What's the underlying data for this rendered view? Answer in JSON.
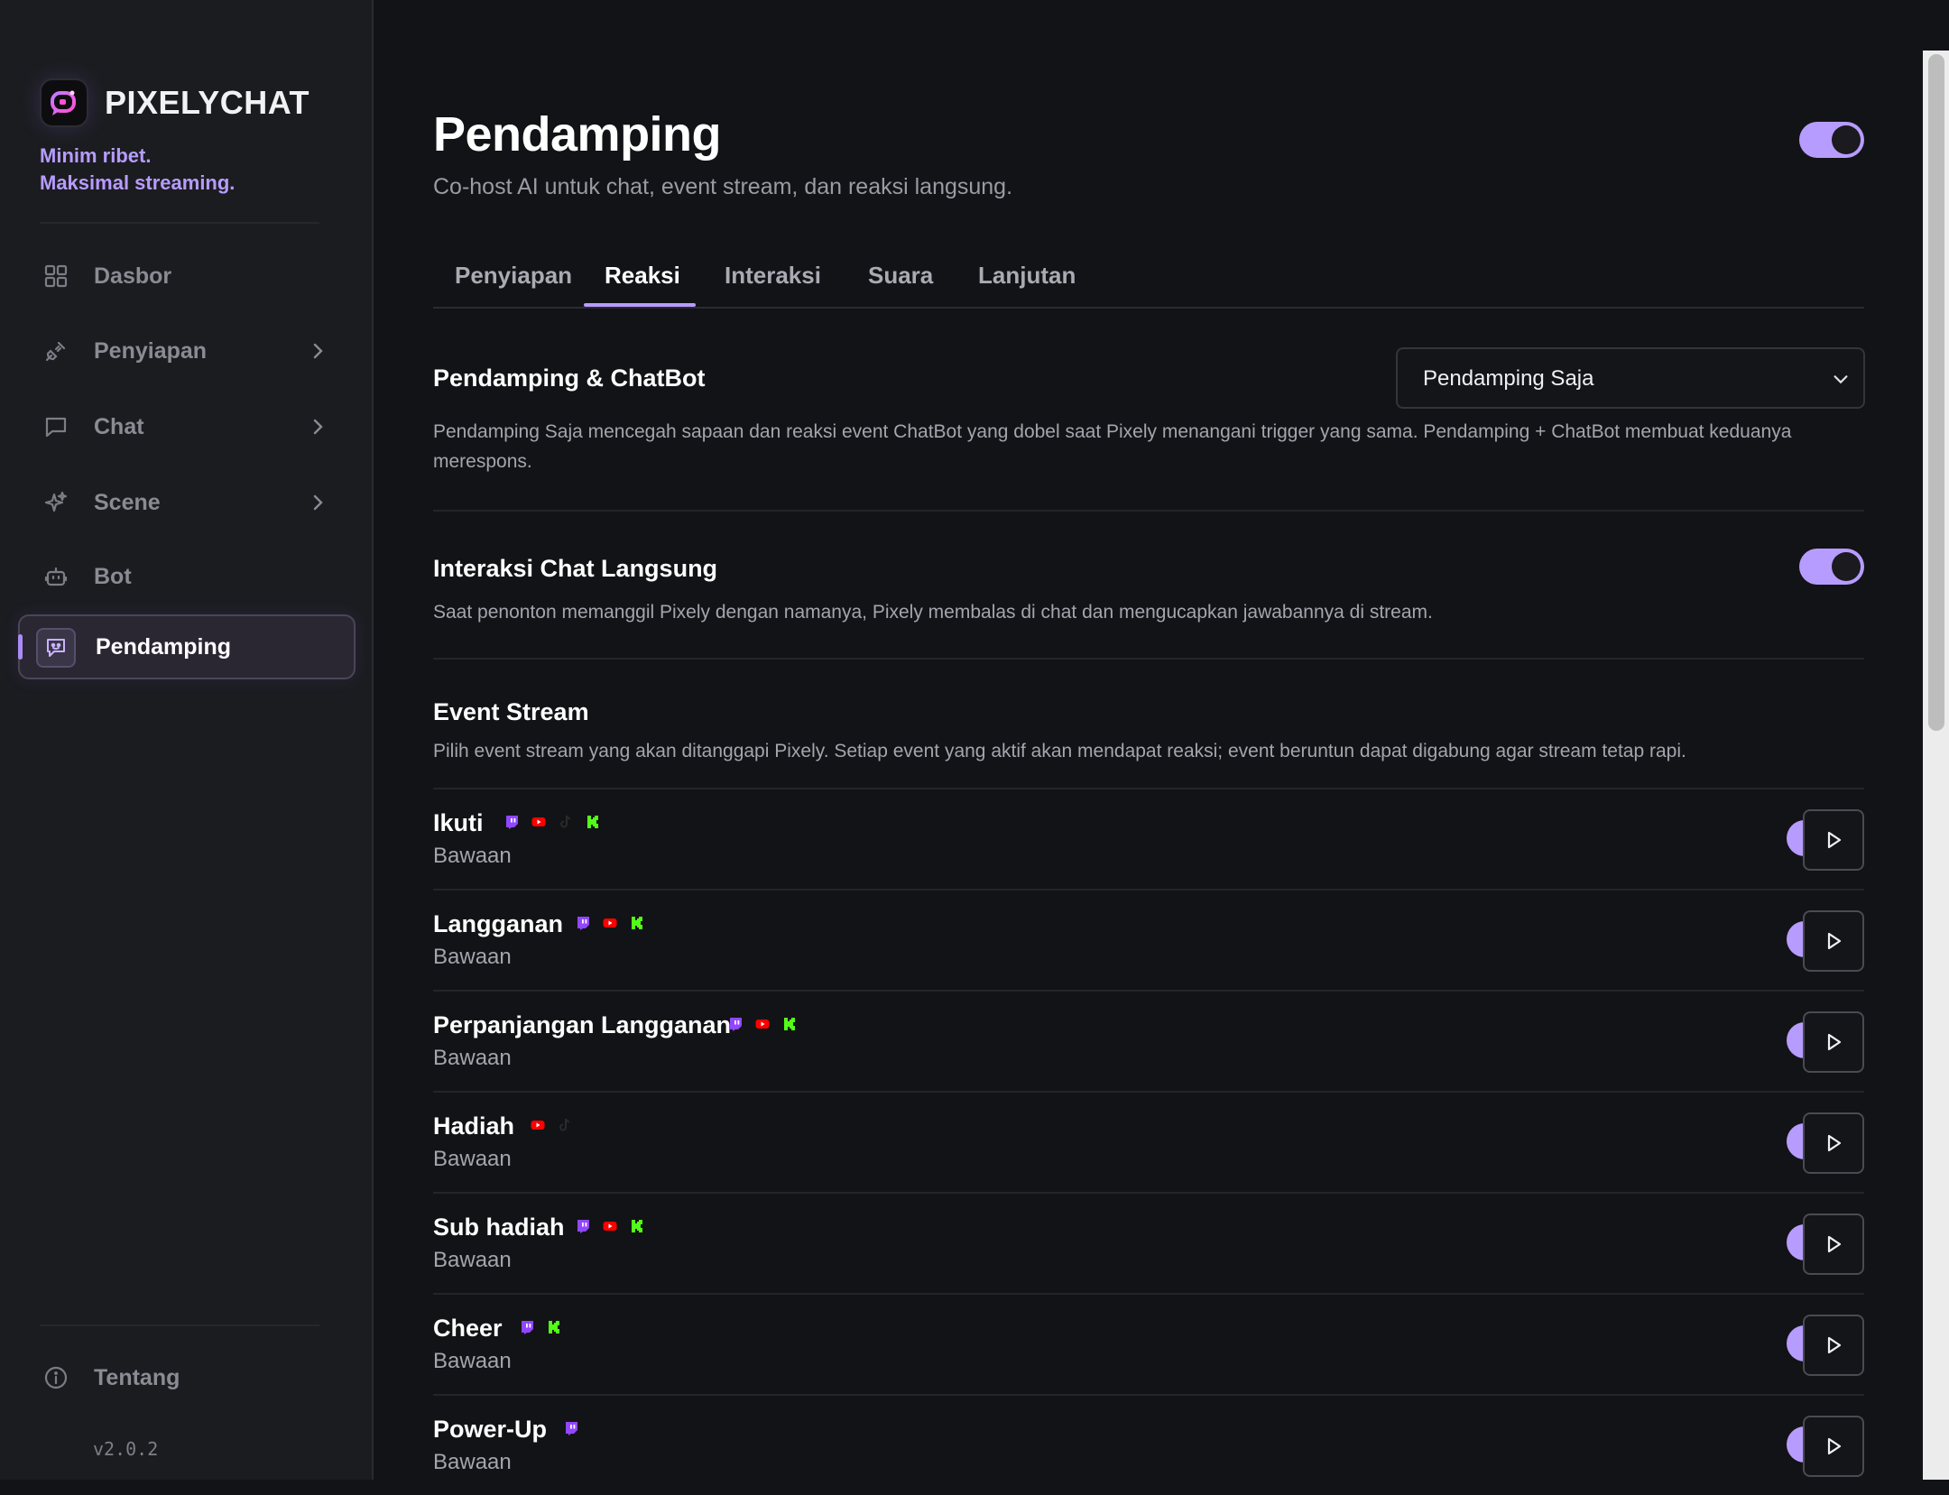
{
  "brand": {
    "name": "PIXELYCHAT",
    "tagline_1": "Minim ribet.",
    "tagline_2": "Maksimal streaming."
  },
  "sidebar": {
    "items": [
      {
        "label": "Dasbor",
        "icon": "grid-icon"
      },
      {
        "label": "Penyiapan",
        "icon": "plug-icon"
      },
      {
        "label": "Chat",
        "icon": "chat-bubble-icon"
      },
      {
        "label": "Scene",
        "icon": "sparkles-icon"
      },
      {
        "label": "Bot",
        "icon": "robot-icon"
      },
      {
        "label": "Pendamping",
        "icon": "companion-icon",
        "active": true
      }
    ],
    "about": {
      "label": "Tentang",
      "icon": "info-icon"
    },
    "version": "v2.0.2"
  },
  "header": {
    "title": "Pendamping",
    "subtitle": "Co-host AI untuk chat, event stream, dan reaksi langsung.",
    "enabled": true
  },
  "tabs": [
    "Penyiapan",
    "Reaksi",
    "Interaksi",
    "Suara",
    "Lanjutan"
  ],
  "active_tab": "Reaksi",
  "companion_chatbot": {
    "title": "Pendamping & ChatBot",
    "selected": "Pendamping Saja",
    "description": "Pendamping Saja mencegah sapaan dan reaksi event ChatBot yang dobel saat Pixely menangani trigger yang sama. Pendamping + ChatBot membuat keduanya merespons."
  },
  "live_chat": {
    "title": "Interaksi Chat Langsung",
    "description": "Saat penonton memanggil Pixely dengan namanya, Pixely membalas di chat dan mengucapkan jawabannya di stream.",
    "enabled": true
  },
  "event_stream": {
    "title": "Event Stream",
    "description": "Pilih event stream yang akan ditanggapi Pixely. Setiap event yang aktif akan mendapat reaksi; event beruntun dapat digabung agar stream tetap rapi.",
    "events": [
      {
        "name": "Ikuti",
        "sub": "Bawaan",
        "platforms": [
          "twitch",
          "youtube",
          "tiktok",
          "kick"
        ],
        "enabled": true
      },
      {
        "name": "Langganan",
        "sub": "Bawaan",
        "platforms": [
          "twitch",
          "youtube",
          "kick"
        ],
        "enabled": true
      },
      {
        "name": "Perpanjangan Langganan",
        "sub": "Bawaan",
        "platforms": [
          "twitch",
          "youtube",
          "kick"
        ],
        "enabled": true
      },
      {
        "name": "Hadiah",
        "sub": "Bawaan",
        "platforms": [
          "youtube",
          "tiktok"
        ],
        "enabled": true
      },
      {
        "name": "Sub hadiah",
        "sub": "Bawaan",
        "platforms": [
          "twitch",
          "youtube",
          "kick"
        ],
        "enabled": true
      },
      {
        "name": "Cheer",
        "sub": "Bawaan",
        "platforms": [
          "twitch",
          "kick"
        ],
        "enabled": true
      },
      {
        "name": "Power-Up",
        "sub": "Bawaan",
        "platforms": [
          "twitch"
        ],
        "enabled": true
      }
    ]
  },
  "colors": {
    "accent": "#b79cff",
    "twitch": "#9146ff",
    "youtube": "#ff0000",
    "tiktok": "#2a2a2a",
    "kick": "#53fc18"
  }
}
